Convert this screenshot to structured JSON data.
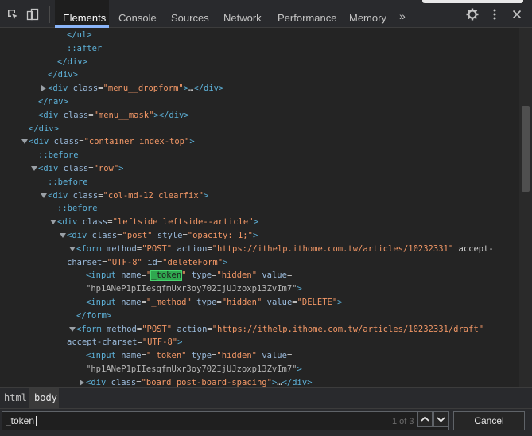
{
  "toolbar": {
    "tabs": [
      {
        "label": "Elements",
        "active": true
      },
      {
        "label": "Console",
        "active": false
      },
      {
        "label": "Sources",
        "active": false
      },
      {
        "label": "Network",
        "active": false
      },
      {
        "label": "Performance",
        "active": false
      },
      {
        "label": "Memory",
        "active": false
      }
    ],
    "overflow": "»",
    "icons": [
      "inspect-element-icon",
      "device-toolbar-icon",
      "overflow-tabs-icon",
      "settings-gear-icon",
      "more-options-icon",
      "close-icon"
    ]
  },
  "tree": {
    "lines": [
      {
        "t": "</ul>"
      },
      {
        "t": "::after"
      },
      {
        "t": "</div>"
      },
      {
        "t": "</div>"
      },
      {
        "t": "<div class=\"menu__dropform\">…</div>"
      },
      {
        "t": "</nav>"
      },
      {
        "t": "<div class=\"menu__mask\"></div>"
      },
      {
        "t": "</div>"
      },
      {
        "t": "<div class=\"container index-top\">"
      },
      {
        "t": "::before"
      },
      {
        "t": "<div class=\"row\">"
      },
      {
        "t": "::before"
      },
      {
        "t": "<div class=\"col-md-12 clearfix\">"
      },
      {
        "t": "::before"
      },
      {
        "t": "<div class=\"leftside leftside--article\">"
      },
      {
        "t": "<div class=\"post\" style=\"opacity: 1;\">"
      },
      {
        "t": "<form method=\"POST\" action=\"https://ithelp.ithome.com.tw/articles/10232331\" accept-"
      },
      {
        "t": "charset=\"UTF-8\" id=\"deleteForm\">"
      },
      {
        "t": "<input name=\"_token\" type=\"hidden\" value="
      },
      {
        "t": "\"hp1ANeP1pIIesqfmUxr3oy702IjUJzoxp13ZvIm7\">"
      },
      {
        "t": "<input name=\"_method\" type=\"hidden\" value=\"DELETE\">"
      },
      {
        "t": "</form>"
      },
      {
        "t": "<form method=\"POST\" action=\"https://ithelp.ithome.com.tw/articles/10232331/draft\""
      },
      {
        "t": "accept-charset=\"UTF-8\">"
      },
      {
        "t": "<input name=\"_token\" type=\"hidden\" value="
      },
      {
        "t": "\"hp1ANeP1pIIesqfmUxr3oy702IjUJzoxp13ZvIm7\">"
      },
      {
        "t": "<div class=\"board post-board-spacing\">…</div>"
      }
    ]
  },
  "breadcrumb": {
    "items": [
      {
        "label": "html",
        "active": false
      },
      {
        "label": "body",
        "active": true
      }
    ]
  },
  "search": {
    "value": "_token",
    "match_count": "1 of 3",
    "cancel_label": "Cancel"
  },
  "colors": {
    "tag": "#5db0d7",
    "attr_name": "#9bbbdc",
    "attr_value": "#f29766",
    "highlight": "#2fa84f",
    "active_tab_underline": "#8ab4f8"
  }
}
